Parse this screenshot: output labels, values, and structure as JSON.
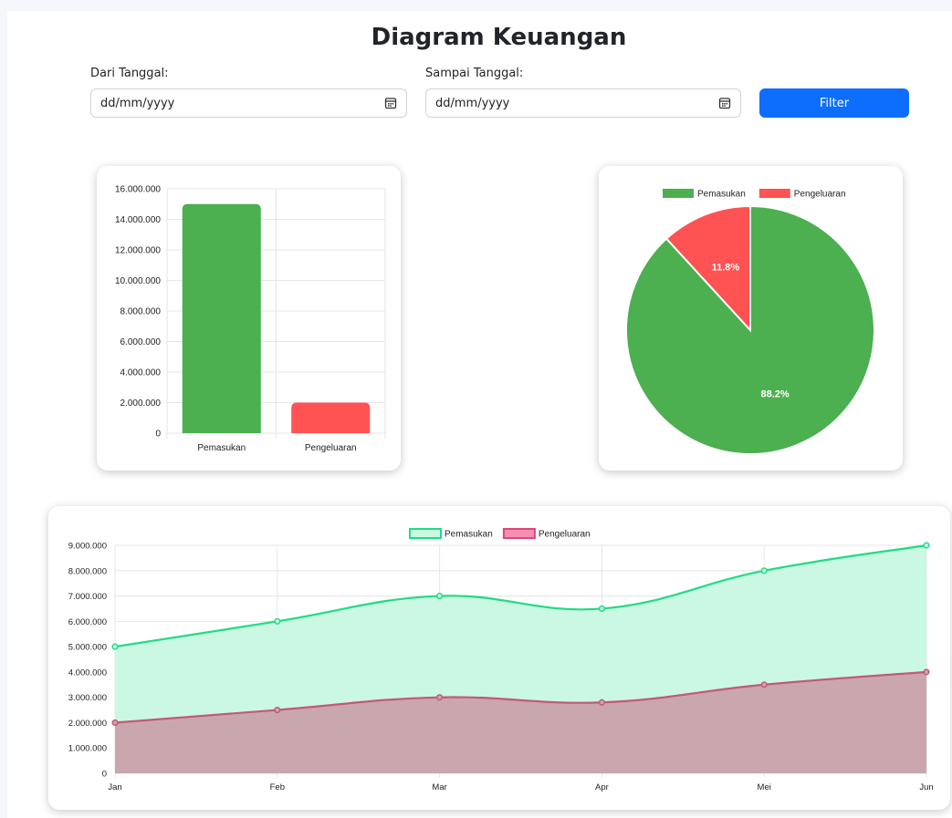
{
  "title": "Diagram Keuangan",
  "filter": {
    "from_label": "Dari Tanggal:",
    "from_placeholder": "dd/mm/yyyy",
    "to_label": "Sampai Tanggal:",
    "to_placeholder": "dd/mm/yyyy",
    "button_label": "Filter"
  },
  "icons": {
    "date_picker": "calendar-icon"
  },
  "colors": {
    "income": "#4caf50",
    "expense": "#ff5252",
    "line_income": "#1fdc83",
    "line_income_fill": "#cbf8e3",
    "line_expense": "#c35a72",
    "line_expense_fill": "#c9a7ad",
    "button": "#0d6efd"
  },
  "chart_data": [
    {
      "type": "bar",
      "categories": [
        "Pemasukan",
        "Pengeluaran"
      ],
      "values": [
        15000000,
        2000000
      ],
      "colors": [
        "#4caf50",
        "#ff5252"
      ],
      "ylim": [
        0,
        16000000
      ],
      "yticks": [
        "0",
        "2.000.000",
        "4.000.000",
        "6.000.000",
        "8.000.000",
        "10.000.000",
        "12.000.000",
        "14.000.000",
        "16.000.000"
      ],
      "legend": "none"
    },
    {
      "type": "pie",
      "labels": [
        "Pemasukan",
        "Pengeluaran"
      ],
      "values": [
        88.2,
        11.8
      ],
      "data_labels": [
        "88.2%",
        "11.8%"
      ],
      "colors": [
        "#4caf50",
        "#ff5252"
      ],
      "legend": "top"
    },
    {
      "type": "area",
      "categories": [
        "Jan",
        "Feb",
        "Mar",
        "Apr",
        "Mei",
        "Jun"
      ],
      "series": [
        {
          "name": "Pemasukan",
          "values": [
            5000000,
            6000000,
            7000000,
            6500000,
            8000000,
            9000000
          ]
        },
        {
          "name": "Pengeluaran",
          "values": [
            2000000,
            2500000,
            3000000,
            2800000,
            3500000,
            4000000
          ]
        }
      ],
      "ylim": [
        0,
        9000000
      ],
      "yticks": [
        "0",
        "1.000.000",
        "2.000.000",
        "3.000.000",
        "4.000.000",
        "5.000.000",
        "6.000.000",
        "7.000.000",
        "8.000.000",
        "9.000.000"
      ],
      "legend": "top",
      "grid": true
    }
  ]
}
